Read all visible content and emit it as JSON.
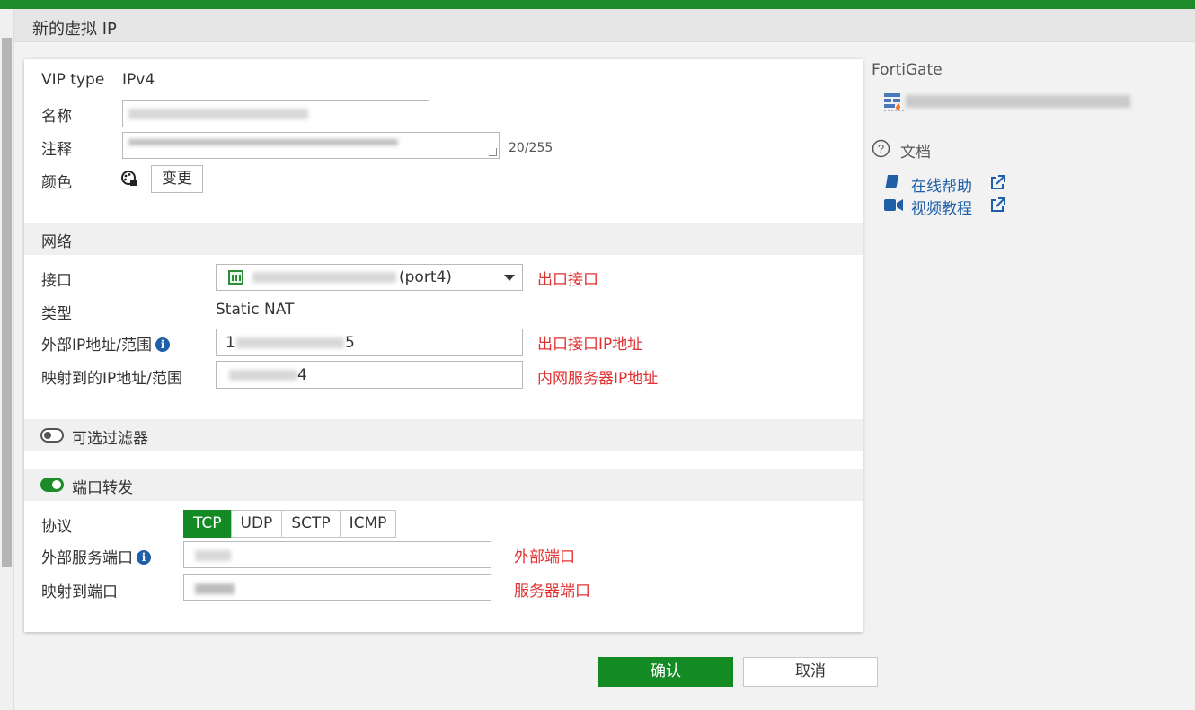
{
  "window": {
    "title": "新的虚拟 IP"
  },
  "form": {
    "vip_type_label": "VIP type",
    "vip_type_value": "IPv4",
    "name_label": "名称",
    "comment_label": "注释",
    "comment_counter": "20/255",
    "color_label": "颜色",
    "change_button": "变更"
  },
  "network": {
    "section_title": "网络",
    "interface_label": "接口",
    "interface_port": "(port4)",
    "interface_annotation": "出口接口",
    "type_label": "类型",
    "type_value": "Static NAT",
    "external_ip_label": "外部IP地址/范围",
    "external_ip_visible_start": "1",
    "external_ip_visible_end": "5",
    "external_ip_annotation": "出口接口IP地址",
    "mapped_ip_label": "映射到的IP地址/范围",
    "mapped_ip_visible_end": "4",
    "mapped_ip_annotation": "内网服务器IP地址"
  },
  "optional_filter": {
    "label": "可选过滤器",
    "enabled": false
  },
  "port_forwarding": {
    "label": "端口转发",
    "enabled": true,
    "protocol_label": "协议",
    "protocols": [
      "TCP",
      "UDP",
      "SCTP",
      "ICMP"
    ],
    "selected_protocol": "TCP",
    "external_port_label": "外部服务端口",
    "external_port_annotation": "外部端口",
    "mapped_port_label": "映射到端口",
    "mapped_port_annotation": "服务器端口"
  },
  "sidebar": {
    "device_title": "FortiGate",
    "docs_title": "文档",
    "online_help": "在线帮助",
    "video_tutorial": "视频教程"
  },
  "footer": {
    "ok_label": "确认",
    "cancel_label": "取消"
  },
  "colors": {
    "accent": "#148a25",
    "annotation": "#e03131",
    "link": "#1f5fa8"
  }
}
